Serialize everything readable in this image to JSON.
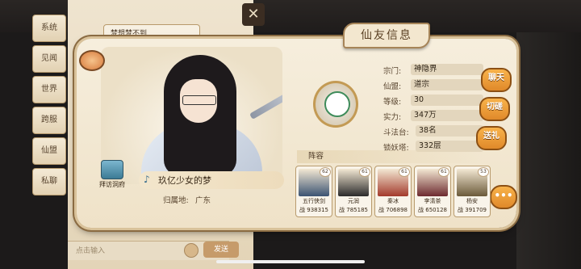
{
  "side_tabs": [
    "系统",
    "见闻",
    "世界",
    "跨服",
    "仙盟",
    "私聊"
  ],
  "chat": {
    "preview": "梦想梦不到",
    "input_placeholder": "点击输入",
    "send_label": "发送"
  },
  "panel": {
    "title": "仙友信息",
    "close_glyph": "✕",
    "chat_button_label": "拜访洞府",
    "player_name": "玖亿少女的梦",
    "home_label": "归属地:",
    "home_value": "广东"
  },
  "stats": [
    {
      "key": "宗门:",
      "value": "神隐界"
    },
    {
      "key": "仙盟:",
      "value": "道宗"
    },
    {
      "key": "等级:",
      "value": "30"
    },
    {
      "key": "实力:",
      "value": "347万"
    },
    {
      "key": "斗法台:",
      "value": "38名"
    },
    {
      "key": "锁妖塔:",
      "value": "332层"
    }
  ],
  "actions": {
    "chat": "聊天",
    "duel": "切磋",
    "gift": "送礼",
    "more": "•••"
  },
  "lineup": {
    "label": "阵容",
    "power_prefix": "战",
    "heroes": [
      {
        "name": "五行侠剑",
        "level": "62",
        "power": "938315",
        "color": "#3b5372"
      },
      {
        "name": "元润",
        "level": "61",
        "power": "785185",
        "color": "#2b2b2b"
      },
      {
        "name": "秦冰",
        "level": "61",
        "power": "706898",
        "color": "#a33a2c"
      },
      {
        "name": "李清茶",
        "level": "61",
        "power": "650128",
        "color": "#6d2a2f"
      },
      {
        "name": "杨安",
        "level": "53",
        "power": "391709",
        "color": "#6b5a3a"
      }
    ]
  }
}
